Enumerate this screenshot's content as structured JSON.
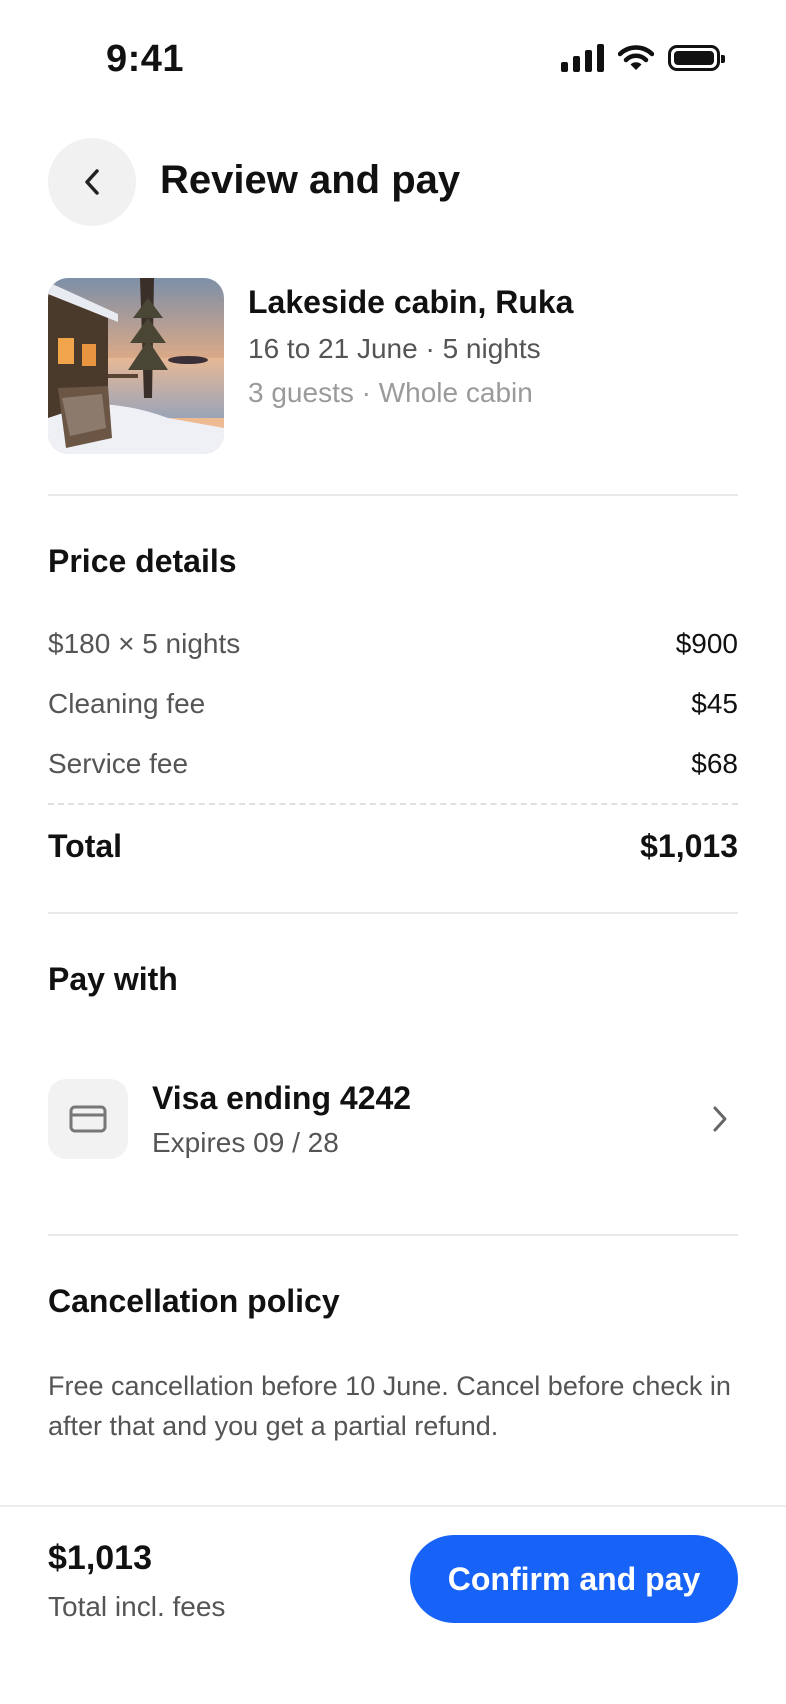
{
  "status_bar": {
    "time": "9:41",
    "icons": [
      "signal-icon",
      "wifi-icon",
      "battery-icon"
    ]
  },
  "header": {
    "title": "Review and pay",
    "back_icon": "chevron-left-icon"
  },
  "listing": {
    "title": "Lakeside cabin, Ruka",
    "dates": "16 to 21 June · 5 nights",
    "guests": "3 guests · Whole cabin"
  },
  "price_details": {
    "title": "Price details",
    "rows": [
      {
        "label": "$180 × 5 nights",
        "value": "$900"
      },
      {
        "label": "Cleaning fee",
        "value": "$45"
      },
      {
        "label": "Service fee",
        "value": "$68"
      }
    ],
    "total_label": "Total",
    "total_value": "$1,013"
  },
  "payment": {
    "title": "Pay with",
    "card_name": "Visa ending 4242",
    "card_expiry": "Expires 09 / 28",
    "card_icon": "credit-card-icon",
    "chevron_icon": "chevron-right-icon"
  },
  "cancellation": {
    "title": "Cancellation policy",
    "text": "Free cancellation before 10 June. Cancel before check in after that and you get a partial refund."
  },
  "footer": {
    "price": "$1,013",
    "caption": "Total incl. fees",
    "button_label": "Confirm and pay"
  },
  "colors": {
    "accent": "#1763f7",
    "text_primary": "#111111",
    "text_secondary": "#555555",
    "text_muted": "#9a9a9a",
    "divider": "#e8e8e8"
  }
}
